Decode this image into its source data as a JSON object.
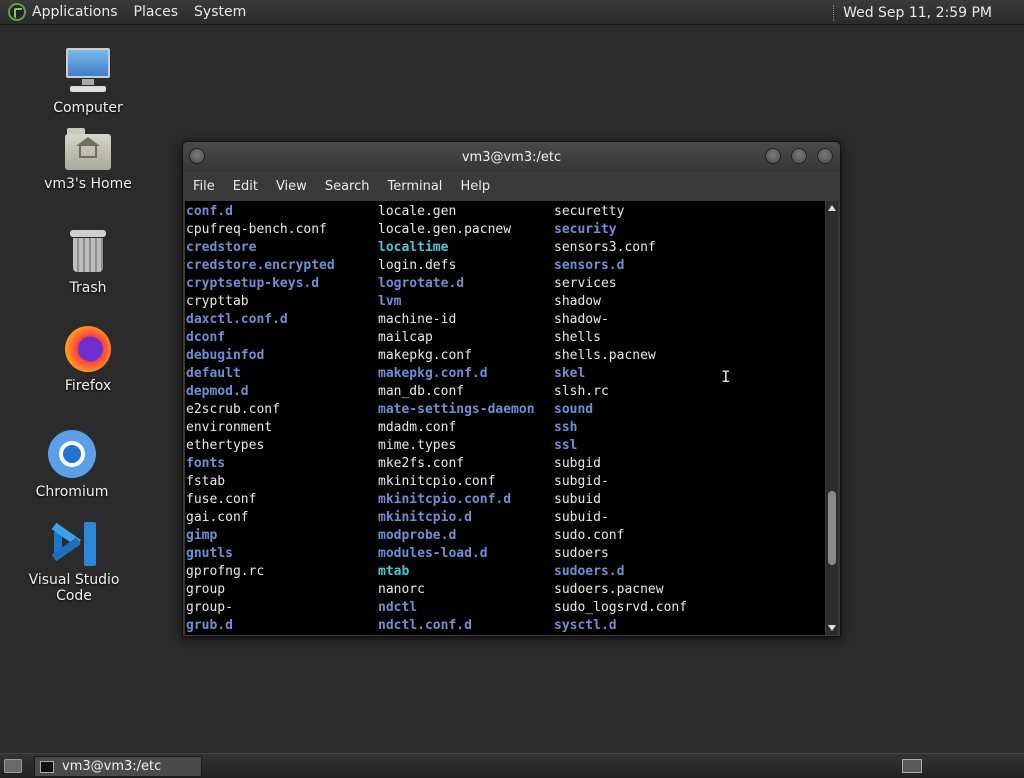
{
  "top_panel": {
    "menus": [
      "Applications",
      "Places",
      "System"
    ],
    "clock": "Wed Sep 11,  2:59 PM"
  },
  "desktop_icons": [
    {
      "label": "Computer",
      "icon": "computer-icon"
    },
    {
      "label": "vm3's Home",
      "icon": "home-folder-icon"
    },
    {
      "label": "Trash",
      "icon": "trash-icon"
    },
    {
      "label": "Firefox",
      "icon": "firefox-icon"
    },
    {
      "label": "Chromium",
      "icon": "chromium-icon"
    },
    {
      "label": "Visual Studio Code",
      "icon": "vscode-icon"
    }
  ],
  "terminal": {
    "title": "vm3@vm3:/etc",
    "menu": [
      "File",
      "Edit",
      "View",
      "Search",
      "Terminal",
      "Help"
    ],
    "colors": {
      "directory": "#6d8fd4",
      "symlink": "#48c8d8",
      "file": "#e8e8e8",
      "background": "#000000"
    },
    "columns": [
      [
        {
          "name": "conf.d",
          "type": "dir"
        },
        {
          "name": "cpufreq-bench.conf",
          "type": "file"
        },
        {
          "name": "credstore",
          "type": "dir"
        },
        {
          "name": "credstore.encrypted",
          "type": "dir"
        },
        {
          "name": "cryptsetup-keys.d",
          "type": "dir"
        },
        {
          "name": "crypttab",
          "type": "file"
        },
        {
          "name": "daxctl.conf.d",
          "type": "dir"
        },
        {
          "name": "dconf",
          "type": "dir"
        },
        {
          "name": "debuginfod",
          "type": "dir"
        },
        {
          "name": "default",
          "type": "dir"
        },
        {
          "name": "depmod.d",
          "type": "dir"
        },
        {
          "name": "e2scrub.conf",
          "type": "file"
        },
        {
          "name": "environment",
          "type": "file"
        },
        {
          "name": "ethertypes",
          "type": "file"
        },
        {
          "name": "fonts",
          "type": "dir"
        },
        {
          "name": "fstab",
          "type": "file"
        },
        {
          "name": "fuse.conf",
          "type": "file"
        },
        {
          "name": "gai.conf",
          "type": "file"
        },
        {
          "name": "gimp",
          "type": "dir"
        },
        {
          "name": "gnutls",
          "type": "dir"
        },
        {
          "name": "gprofng.rc",
          "type": "file"
        },
        {
          "name": "group",
          "type": "file"
        },
        {
          "name": "group-",
          "type": "file"
        },
        {
          "name": "grub.d",
          "type": "dir"
        }
      ],
      [
        {
          "name": "locale.gen",
          "type": "file"
        },
        {
          "name": "locale.gen.pacnew",
          "type": "file"
        },
        {
          "name": "localtime",
          "type": "link"
        },
        {
          "name": "login.defs",
          "type": "file"
        },
        {
          "name": "logrotate.d",
          "type": "dir"
        },
        {
          "name": "lvm",
          "type": "dir"
        },
        {
          "name": "machine-id",
          "type": "file"
        },
        {
          "name": "mailcap",
          "type": "file"
        },
        {
          "name": "makepkg.conf",
          "type": "file"
        },
        {
          "name": "makepkg.conf.d",
          "type": "dir"
        },
        {
          "name": "man_db.conf",
          "type": "file"
        },
        {
          "name": "mate-settings-daemon",
          "type": "dir"
        },
        {
          "name": "mdadm.conf",
          "type": "file"
        },
        {
          "name": "mime.types",
          "type": "file"
        },
        {
          "name": "mke2fs.conf",
          "type": "file"
        },
        {
          "name": "mkinitcpio.conf",
          "type": "file"
        },
        {
          "name": "mkinitcpio.conf.d",
          "type": "dir"
        },
        {
          "name": "mkinitcpio.d",
          "type": "dir"
        },
        {
          "name": "modprobe.d",
          "type": "dir"
        },
        {
          "name": "modules-load.d",
          "type": "dir"
        },
        {
          "name": "mtab",
          "type": "link"
        },
        {
          "name": "nanorc",
          "type": "file"
        },
        {
          "name": "ndctl",
          "type": "dir"
        },
        {
          "name": "ndctl.conf.d",
          "type": "dir"
        }
      ],
      [
        {
          "name": "securetty",
          "type": "file"
        },
        {
          "name": "security",
          "type": "dir"
        },
        {
          "name": "sensors3.conf",
          "type": "file"
        },
        {
          "name": "sensors.d",
          "type": "dir"
        },
        {
          "name": "services",
          "type": "file"
        },
        {
          "name": "shadow",
          "type": "file"
        },
        {
          "name": "shadow-",
          "type": "file"
        },
        {
          "name": "shells",
          "type": "file"
        },
        {
          "name": "shells.pacnew",
          "type": "file"
        },
        {
          "name": "skel",
          "type": "dir"
        },
        {
          "name": "slsh.rc",
          "type": "file"
        },
        {
          "name": "sound",
          "type": "dir"
        },
        {
          "name": "ssh",
          "type": "dir"
        },
        {
          "name": "ssl",
          "type": "dir"
        },
        {
          "name": "subgid",
          "type": "file"
        },
        {
          "name": "subgid-",
          "type": "file"
        },
        {
          "name": "subuid",
          "type": "file"
        },
        {
          "name": "subuid-",
          "type": "file"
        },
        {
          "name": "sudo.conf",
          "type": "file"
        },
        {
          "name": "sudoers",
          "type": "file"
        },
        {
          "name": "sudoers.d",
          "type": "dir"
        },
        {
          "name": "sudoers.pacnew",
          "type": "file"
        },
        {
          "name": "sudo_logsrvd.conf",
          "type": "file"
        },
        {
          "name": "sysctl.d",
          "type": "dir"
        }
      ]
    ]
  },
  "taskbar": {
    "tasks": [
      {
        "label": "vm3@vm3:/etc",
        "icon": "terminal-icon"
      }
    ]
  }
}
